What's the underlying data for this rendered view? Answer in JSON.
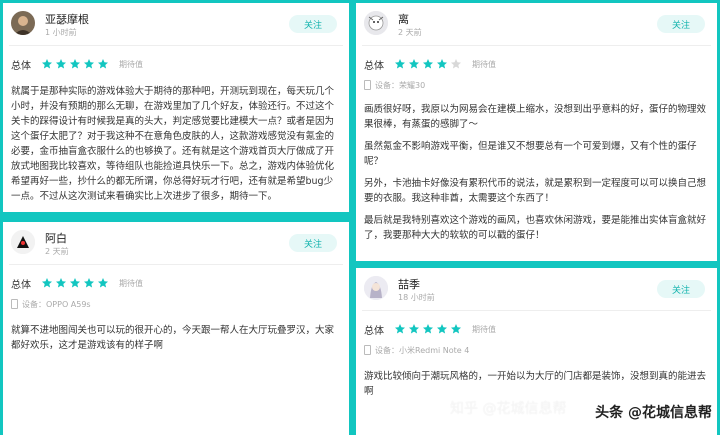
{
  "reviews": [
    {
      "username": "亚瑟摩根",
      "time": "1 小时前",
      "follow": "关注",
      "rating_label": "总体",
      "stars": 5,
      "expect": "期待值",
      "device": "",
      "text": "就属于是那种实际的游戏体验大于期待的那种吧，开测玩到现在，每天玩几个小时，并没有预期的那么无聊，在游戏里加了几个好友，体验还行。不过这个关卡的踩得设计有时候我是真的头大，判定感觉要比建模大一点？或者是因为这个蛋仔太肥了？对于我这种不在意角色皮肤的人，这款游戏感觉没有氪金的必要，金币抽盲盒衣服什么的也够换了。还有就是这个游戏首页大厅做成了开放式地图我比较喜欢，等待组队也能捡道具快乐一下。总之，游戏内体验优化希望再好一些，抄什么的都无所谓，你总得好玩才行吧，还有就是希望bug少一点。不过从这次测试来看确实比上次进步了很多，期待一下。"
    },
    {
      "username": "阿白",
      "time": "2 天前",
      "follow": "关注",
      "rating_label": "总体",
      "stars": 5,
      "expect": "期待值",
      "device": "设备：OPPO A59s",
      "text": "就算不进地图闯关也可以玩的很开心的，今天跟一帮人在大厅玩叠罗汉，大家都好欢乐，这才是游戏该有的样子啊"
    },
    {
      "username": "离",
      "time": "2 天前",
      "follow": "关注",
      "rating_label": "总体",
      "stars": 4,
      "expect": "期待值",
      "device": "设备：荣耀30",
      "paragraphs": [
        "画质很好呀，我原以为网易会在建模上缩水，没想到出乎意料的好，蛋仔的物理效果很棒，有蒸蛋的感脚了～",
        "虽然氪金不影响游戏平衡，但是谁又不想要总有一个可爱到爆，又有个性的蛋仔呢？",
        "另外，卡池抽卡好像没有累积代币的说法，就是累积到一定程度可以可以换自己想要的衣服。我这种非酋，太需要这个东西了！",
        "最后就是我特别喜欢这个游戏的画风，也喜欢休闲游戏，要是能推出实体盲盒就好了，我要那种大大的软软的可以戳的蛋仔！"
      ]
    },
    {
      "username": "喆季",
      "time": "18 小时前",
      "follow": "关注",
      "rating_label": "总体",
      "stars": 5,
      "expect": "期待值",
      "device": "设备：小米Redmi Note 4",
      "text": "游戏比较倾向于潮玩风格的，一开始以为大厅的门店都是装饰，没想到真的能进去啊"
    }
  ],
  "watermark": "知乎 @花城信息帮",
  "source": "头条 @花城信息帮",
  "colors": {
    "accent": "#12c6c0",
    "star": "#12c6c0",
    "star_empty": "#d8d8d8"
  }
}
